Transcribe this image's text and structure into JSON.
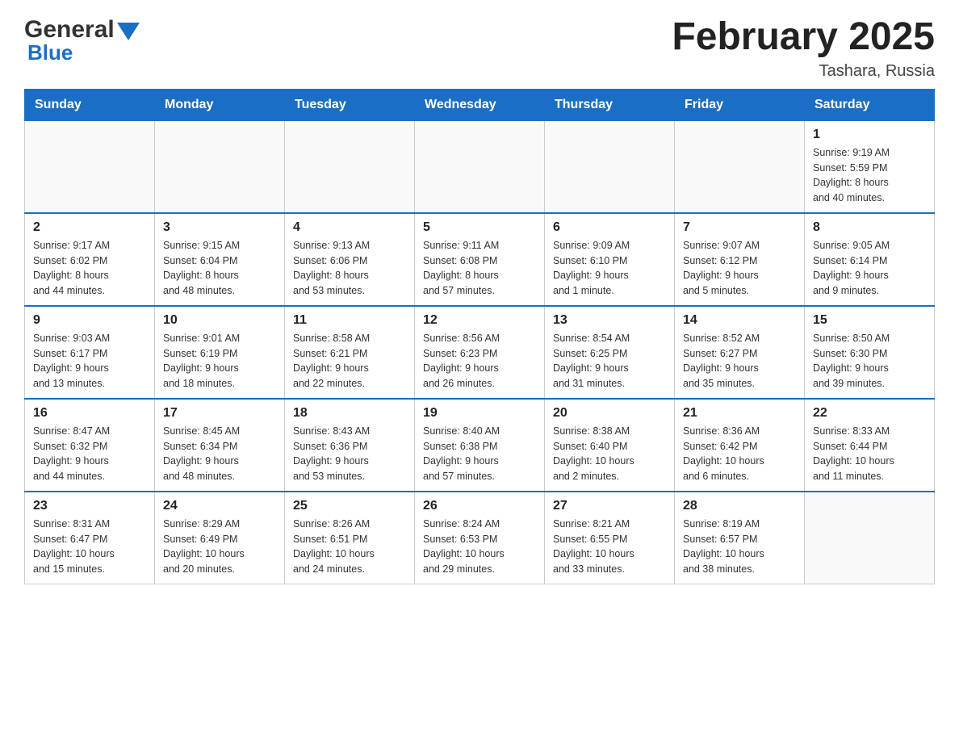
{
  "logo": {
    "general": "General",
    "blue": "Blue",
    "arrow": "▶"
  },
  "header": {
    "title": "February 2025",
    "location": "Tashara, Russia"
  },
  "weekdays": [
    "Sunday",
    "Monday",
    "Tuesday",
    "Wednesday",
    "Thursday",
    "Friday",
    "Saturday"
  ],
  "weeks": [
    [
      {
        "day": "",
        "info": ""
      },
      {
        "day": "",
        "info": ""
      },
      {
        "day": "",
        "info": ""
      },
      {
        "day": "",
        "info": ""
      },
      {
        "day": "",
        "info": ""
      },
      {
        "day": "",
        "info": ""
      },
      {
        "day": "1",
        "info": "Sunrise: 9:19 AM\nSunset: 5:59 PM\nDaylight: 8 hours\nand 40 minutes."
      }
    ],
    [
      {
        "day": "2",
        "info": "Sunrise: 9:17 AM\nSunset: 6:02 PM\nDaylight: 8 hours\nand 44 minutes."
      },
      {
        "day": "3",
        "info": "Sunrise: 9:15 AM\nSunset: 6:04 PM\nDaylight: 8 hours\nand 48 minutes."
      },
      {
        "day": "4",
        "info": "Sunrise: 9:13 AM\nSunset: 6:06 PM\nDaylight: 8 hours\nand 53 minutes."
      },
      {
        "day": "5",
        "info": "Sunrise: 9:11 AM\nSunset: 6:08 PM\nDaylight: 8 hours\nand 57 minutes."
      },
      {
        "day": "6",
        "info": "Sunrise: 9:09 AM\nSunset: 6:10 PM\nDaylight: 9 hours\nand 1 minute."
      },
      {
        "day": "7",
        "info": "Sunrise: 9:07 AM\nSunset: 6:12 PM\nDaylight: 9 hours\nand 5 minutes."
      },
      {
        "day": "8",
        "info": "Sunrise: 9:05 AM\nSunset: 6:14 PM\nDaylight: 9 hours\nand 9 minutes."
      }
    ],
    [
      {
        "day": "9",
        "info": "Sunrise: 9:03 AM\nSunset: 6:17 PM\nDaylight: 9 hours\nand 13 minutes."
      },
      {
        "day": "10",
        "info": "Sunrise: 9:01 AM\nSunset: 6:19 PM\nDaylight: 9 hours\nand 18 minutes."
      },
      {
        "day": "11",
        "info": "Sunrise: 8:58 AM\nSunset: 6:21 PM\nDaylight: 9 hours\nand 22 minutes."
      },
      {
        "day": "12",
        "info": "Sunrise: 8:56 AM\nSunset: 6:23 PM\nDaylight: 9 hours\nand 26 minutes."
      },
      {
        "day": "13",
        "info": "Sunrise: 8:54 AM\nSunset: 6:25 PM\nDaylight: 9 hours\nand 31 minutes."
      },
      {
        "day": "14",
        "info": "Sunrise: 8:52 AM\nSunset: 6:27 PM\nDaylight: 9 hours\nand 35 minutes."
      },
      {
        "day": "15",
        "info": "Sunrise: 8:50 AM\nSunset: 6:30 PM\nDaylight: 9 hours\nand 39 minutes."
      }
    ],
    [
      {
        "day": "16",
        "info": "Sunrise: 8:47 AM\nSunset: 6:32 PM\nDaylight: 9 hours\nand 44 minutes."
      },
      {
        "day": "17",
        "info": "Sunrise: 8:45 AM\nSunset: 6:34 PM\nDaylight: 9 hours\nand 48 minutes."
      },
      {
        "day": "18",
        "info": "Sunrise: 8:43 AM\nSunset: 6:36 PM\nDaylight: 9 hours\nand 53 minutes."
      },
      {
        "day": "19",
        "info": "Sunrise: 8:40 AM\nSunset: 6:38 PM\nDaylight: 9 hours\nand 57 minutes."
      },
      {
        "day": "20",
        "info": "Sunrise: 8:38 AM\nSunset: 6:40 PM\nDaylight: 10 hours\nand 2 minutes."
      },
      {
        "day": "21",
        "info": "Sunrise: 8:36 AM\nSunset: 6:42 PM\nDaylight: 10 hours\nand 6 minutes."
      },
      {
        "day": "22",
        "info": "Sunrise: 8:33 AM\nSunset: 6:44 PM\nDaylight: 10 hours\nand 11 minutes."
      }
    ],
    [
      {
        "day": "23",
        "info": "Sunrise: 8:31 AM\nSunset: 6:47 PM\nDaylight: 10 hours\nand 15 minutes."
      },
      {
        "day": "24",
        "info": "Sunrise: 8:29 AM\nSunset: 6:49 PM\nDaylight: 10 hours\nand 20 minutes."
      },
      {
        "day": "25",
        "info": "Sunrise: 8:26 AM\nSunset: 6:51 PM\nDaylight: 10 hours\nand 24 minutes."
      },
      {
        "day": "26",
        "info": "Sunrise: 8:24 AM\nSunset: 6:53 PM\nDaylight: 10 hours\nand 29 minutes."
      },
      {
        "day": "27",
        "info": "Sunrise: 8:21 AM\nSunset: 6:55 PM\nDaylight: 10 hours\nand 33 minutes."
      },
      {
        "day": "28",
        "info": "Sunrise: 8:19 AM\nSunset: 6:57 PM\nDaylight: 10 hours\nand 38 minutes."
      },
      {
        "day": "",
        "info": ""
      }
    ]
  ]
}
